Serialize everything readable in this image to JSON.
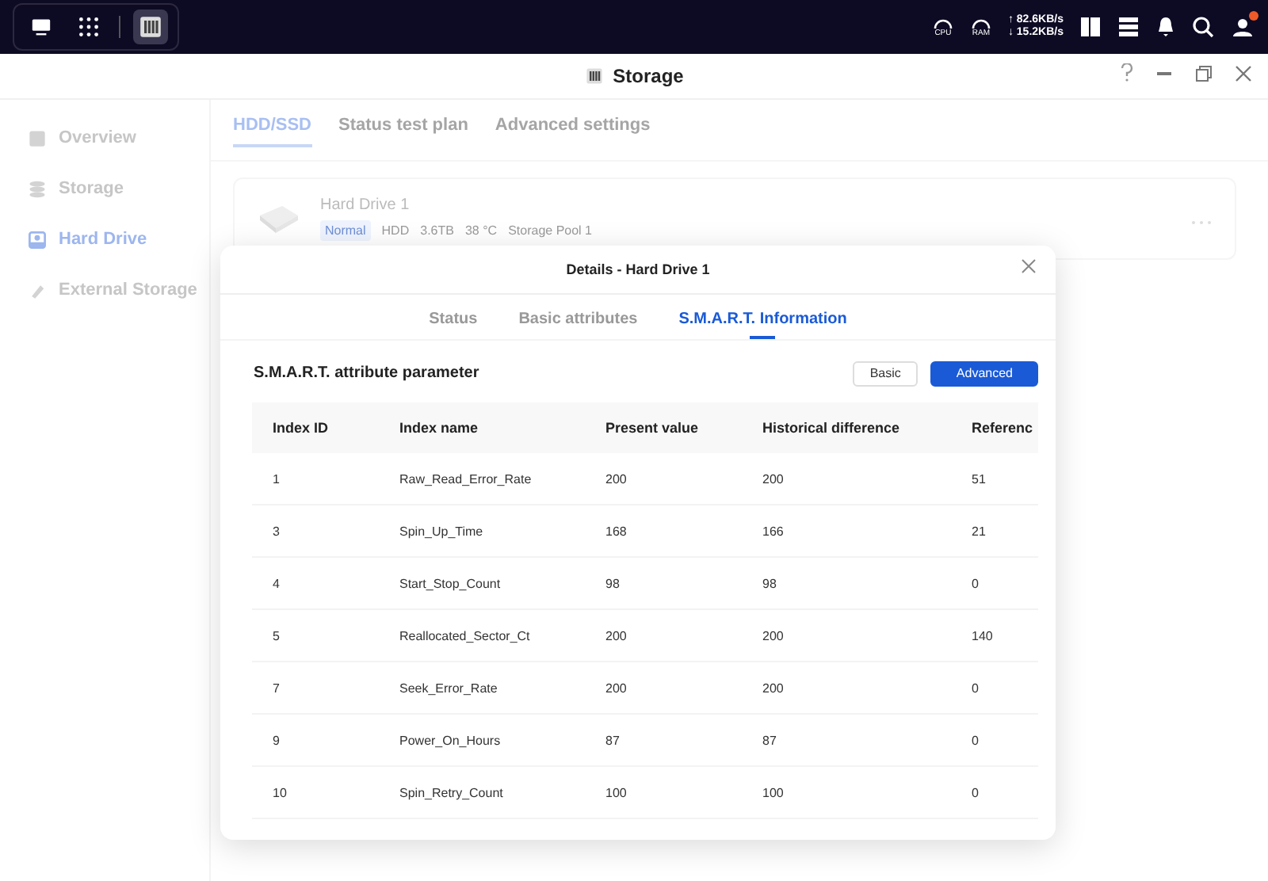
{
  "taskbar": {
    "apps": [
      {
        "kind": "desktop",
        "selected": false
      },
      {
        "kind": "grid",
        "selected": false
      },
      {
        "kind": "storage",
        "selected": true
      }
    ],
    "cpu_label": "CPU",
    "ram_label": "RAM",
    "upload": "↑ 82.6KB/s",
    "download": "↓ 15.2KB/s",
    "notification_badge": true
  },
  "window": {
    "title": "Storage"
  },
  "sidebar": {
    "items": [
      {
        "label": "Overview",
        "kind": "overview",
        "selected": false
      },
      {
        "label": "Storage",
        "kind": "storage",
        "selected": false
      },
      {
        "label": "Hard Drive",
        "kind": "drive",
        "selected": true
      },
      {
        "label": "External Storage",
        "kind": "external",
        "selected": false
      }
    ]
  },
  "tabs": [
    {
      "label": "HDD/SSD",
      "selected": true
    },
    {
      "label": "Status test plan",
      "selected": false
    },
    {
      "label": "Advanced settings",
      "selected": false
    }
  ],
  "drive": {
    "name": "Hard Drive 1",
    "status": "Normal",
    "type": "HDD",
    "size": "3.6TB",
    "temperature": "38 °C",
    "pool": "Storage Pool 1"
  },
  "dialog": {
    "title": "Details - Hard Drive 1",
    "tabs": [
      {
        "label": "Status",
        "selected": false
      },
      {
        "label": "Basic attributes",
        "selected": false
      },
      {
        "label": "S.M.A.R.T. Information",
        "selected": true
      }
    ],
    "section_title": "S.M.A.R.T. attribute parameter",
    "modes": [
      {
        "label": "Basic",
        "selected": false
      },
      {
        "label": "Advanced",
        "selected": true
      }
    ],
    "table": {
      "columns": [
        "Index ID",
        "Index name",
        "Present value",
        "Historical difference",
        "Referenc"
      ],
      "rows": [
        [
          "1",
          "Raw_Read_Error_Rate",
          "200",
          "200",
          "51"
        ],
        [
          "3",
          "Spin_Up_Time",
          "168",
          "166",
          "21"
        ],
        [
          "4",
          "Start_Stop_Count",
          "98",
          "98",
          "0"
        ],
        [
          "5",
          "Reallocated_Sector_Ct",
          "200",
          "200",
          "140"
        ],
        [
          "7",
          "Seek_Error_Rate",
          "200",
          "200",
          "0"
        ],
        [
          "9",
          "Power_On_Hours",
          "87",
          "87",
          "0"
        ],
        [
          "10",
          "Spin_Retry_Count",
          "100",
          "100",
          "0"
        ]
      ]
    }
  }
}
